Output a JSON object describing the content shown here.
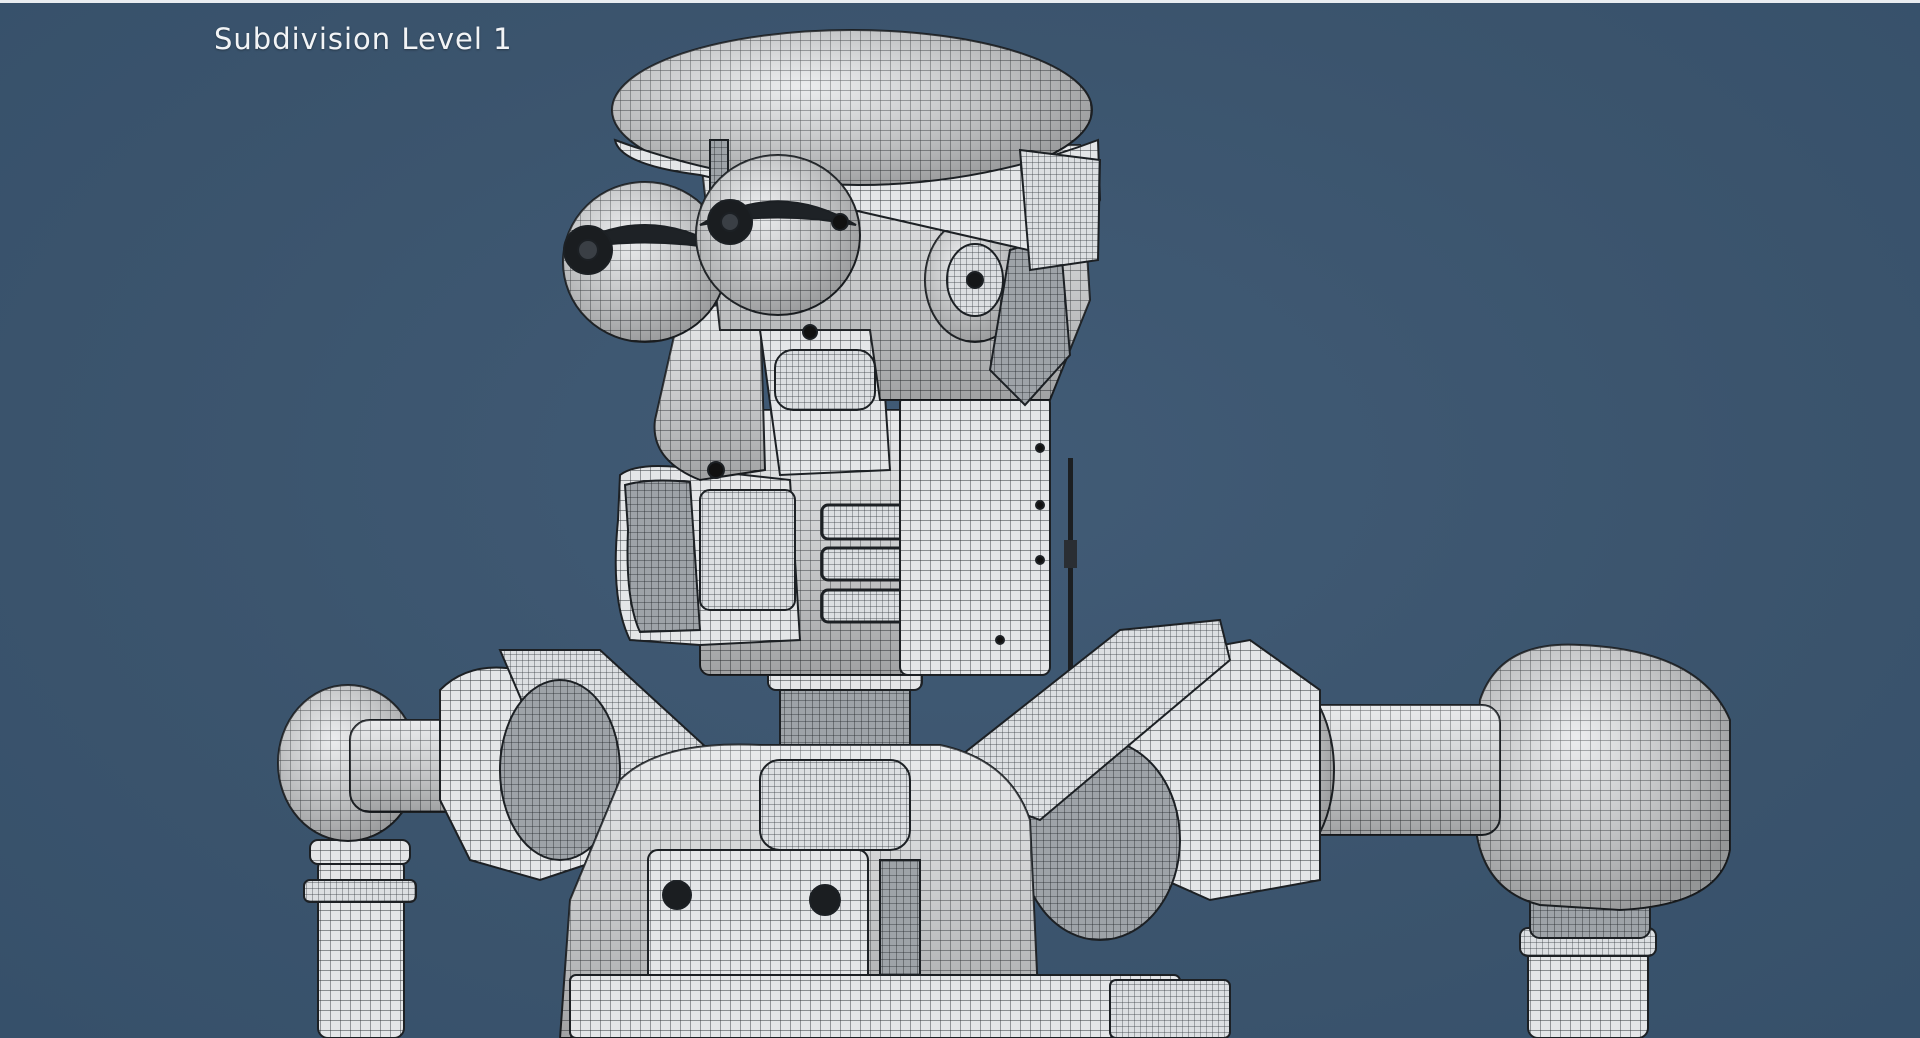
{
  "viewport": {
    "overlay_text": "Subdivision Level 1",
    "background_color": "#3d5670",
    "model_color": "#e6e8ea",
    "wire_color": "#2b2f33"
  },
  "model": {
    "subject": "robot",
    "display_mode": "wireframe-on-shaded"
  }
}
